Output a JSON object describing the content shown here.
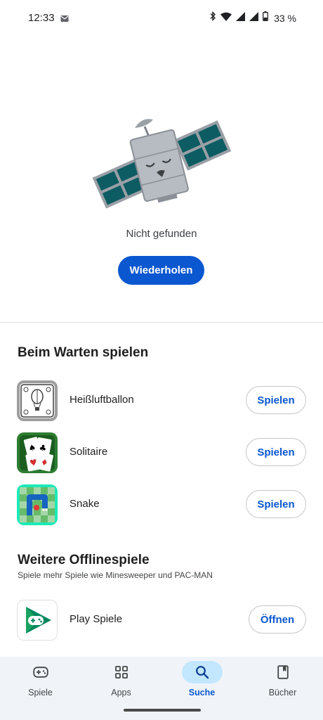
{
  "status_bar": {
    "time": "12:33",
    "battery": "33 %"
  },
  "empty_state": {
    "message": "Nicht gefunden",
    "retry_label": "Wiederholen"
  },
  "waiting_section": {
    "title": "Beim Warten spielen",
    "games": [
      {
        "name": "Heißluftballon",
        "button": "Spielen",
        "icon": "hot-air-balloon-icon"
      },
      {
        "name": "Solitaire",
        "button": "Spielen",
        "icon": "solitaire-cards-icon"
      },
      {
        "name": "Snake",
        "button": "Spielen",
        "icon": "snake-game-icon"
      }
    ]
  },
  "offline_section": {
    "title": "Weitere Offlinespiele",
    "subtitle": "Spiele mehr Spiele wie Minesweeper und PAC-MAN",
    "app": {
      "name": "Play Spiele",
      "button": "Öffnen",
      "icon": "play-games-icon"
    }
  },
  "bottom_nav": {
    "items": [
      {
        "label": "Spiele",
        "icon": "gamepad-icon",
        "active": false
      },
      {
        "label": "Apps",
        "icon": "apps-grid-icon",
        "active": false
      },
      {
        "label": "Suche",
        "icon": "search-icon",
        "active": true
      },
      {
        "label": "Bücher",
        "icon": "book-icon",
        "active": false
      }
    ]
  },
  "colors": {
    "accent": "#0b57d0",
    "nav_active_pill": "#c2e7ff",
    "nav_background": "#f0f4f9"
  }
}
